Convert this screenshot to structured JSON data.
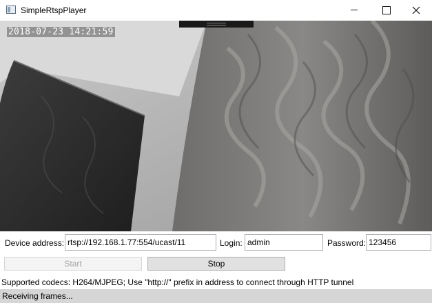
{
  "window": {
    "title": "SimpleRtspPlayer"
  },
  "video": {
    "timestamp": "2018-07-23 14:21:59"
  },
  "form": {
    "device_address_label": "Device address:",
    "device_address_value": "rtsp://192.168.1.77:554/ucast/11",
    "login_label": "Login:",
    "login_value": "admin",
    "password_label": "Password:",
    "password_value": "123456"
  },
  "buttons": {
    "start_label": "Start",
    "stop_label": "Stop"
  },
  "info_text": "Supported codecs: H264/MJPEG; Use \"http://\" prefix in address to connect through HTTP tunnel",
  "status": {
    "text": "Receiving frames..."
  },
  "icons": {
    "app": "app-window-icon",
    "minimize": "minimize-icon",
    "maximize": "maximize-icon",
    "close": "close-icon"
  }
}
